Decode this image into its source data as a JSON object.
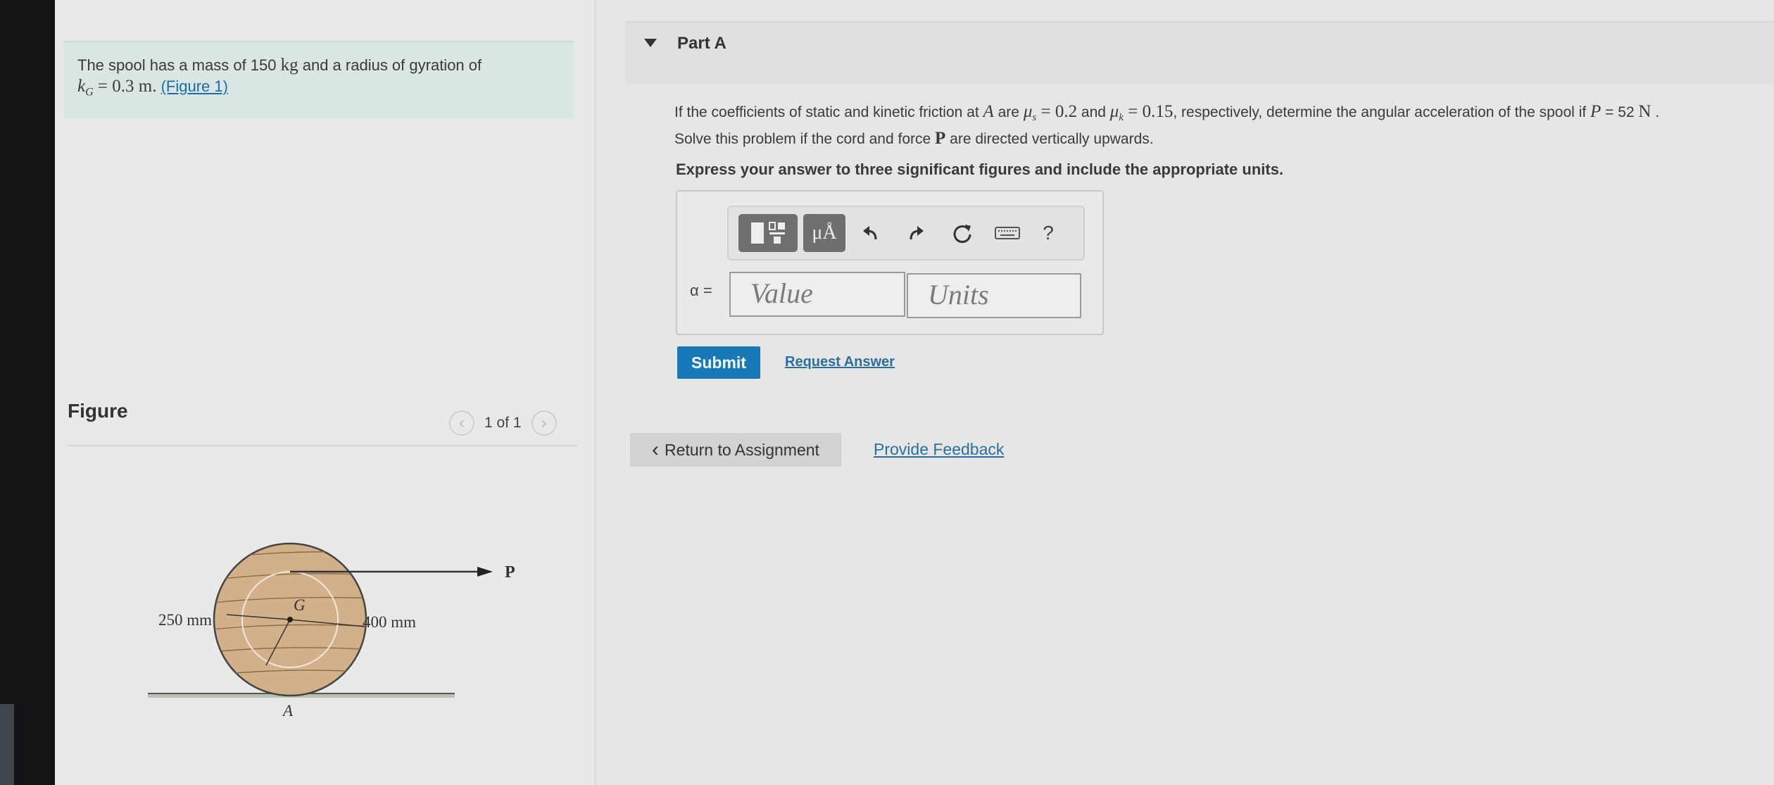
{
  "intro": {
    "text_a": "The spool has a mass of 150 ",
    "unit_kg": "kg",
    "text_b": " and a radius of gyration of",
    "k_symbol": "k",
    "k_sub": "G",
    "k_value": " = 0.3 m.",
    "figure_link": "(Figure 1)"
  },
  "figure": {
    "title": "Figure",
    "counter": "1 of 1",
    "label_250": "250 mm",
    "label_400": "400 mm",
    "label_G": "G",
    "label_P": "P",
    "label_A": "A"
  },
  "part": {
    "title": "Part A",
    "q1": "If the coefficients of static and kinetic friction at ",
    "A": "A",
    "q2": " are ",
    "mu_s": "μ",
    "mu_s_sub": "s",
    "mu_s_val": " = 0.2",
    "q3": " and ",
    "mu_k": "μ",
    "mu_k_sub": "k",
    "mu_k_val": " = 0.15",
    "q4": ", respectively, determine the angular acceleration of the spool if ",
    "P": "P",
    "P_val": " = 52 ",
    "N": "N",
    "q5": " .",
    "line2a": "Solve this problem if the cord and force ",
    "P_bold": "P",
    "line2b": " are directed vertically upwards.",
    "instruction": "Express your answer to three significant figures and include the appropriate units."
  },
  "toolbar": {
    "units_label": "μÅ",
    "help_label": "?"
  },
  "answer": {
    "label": "α =",
    "value_placeholder": "Value",
    "units_placeholder": "Units"
  },
  "buttons": {
    "submit": "Submit",
    "request": "Request Answer",
    "return": "Return to Assignment",
    "feedback": "Provide Feedback"
  },
  "icons": [
    "templates-icon",
    "undo-icon",
    "redo-icon",
    "reset-icon",
    "keyboard-icon",
    "chevron-left-icon",
    "chevron-right-icon",
    "caret-down-icon"
  ]
}
